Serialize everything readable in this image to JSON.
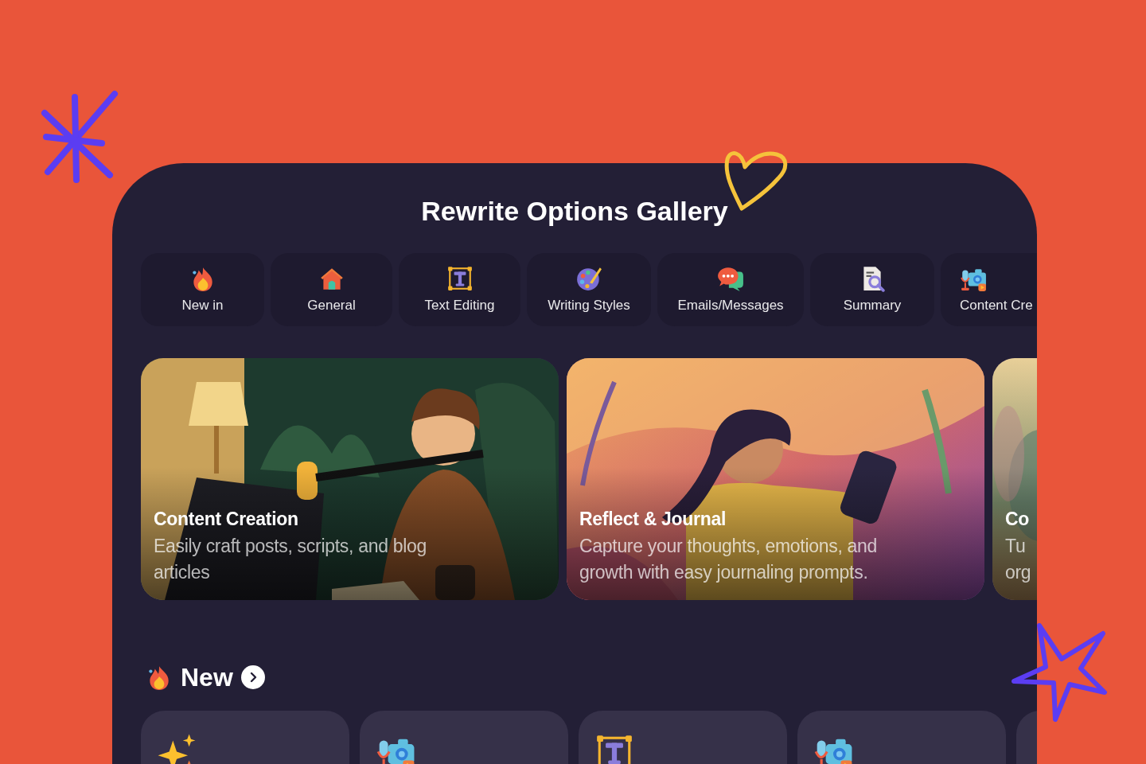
{
  "title": "Rewrite Options Gallery",
  "categories": [
    {
      "label": "New in",
      "kind": "fire"
    },
    {
      "label": "General",
      "kind": "house"
    },
    {
      "label": "Text Editing",
      "kind": "text-frame"
    },
    {
      "label": "Writing Styles",
      "kind": "palette"
    },
    {
      "label": "Emails/Messages",
      "kind": "chat"
    },
    {
      "label": "Summary",
      "kind": "document"
    },
    {
      "label": "Content Cre",
      "kind": "camera"
    }
  ],
  "featured": [
    {
      "title": "Content Creation",
      "description_lines": [
        "Easily craft posts, scripts, and blog",
        "articles"
      ],
      "kind": "podcast"
    },
    {
      "title": "Reflect & Journal",
      "description_lines": [
        "Capture your thoughts, emotions, and",
        "growth with easy journaling prompts."
      ],
      "kind": "journal"
    },
    {
      "title": "Co",
      "description_lines": [
        "Tu",
        "org"
      ],
      "kind": "blur"
    }
  ],
  "section": {
    "title": "New"
  },
  "new_items": [
    {
      "kind": "sparkles"
    },
    {
      "kind": "camera"
    },
    {
      "kind": "text-frame"
    },
    {
      "kind": "camera"
    },
    {
      "kind": "partial"
    }
  ]
}
